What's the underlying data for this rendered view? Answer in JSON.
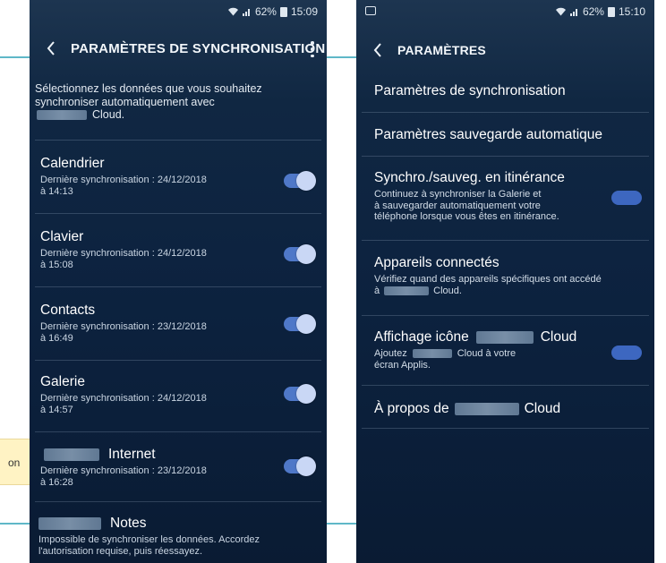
{
  "annotation": {
    "note_text": "on"
  },
  "left_screen": {
    "status": {
      "signal_text": "⚡.ıl",
      "battery": "62%",
      "time": "15:09"
    },
    "title": "PARAMÈTRES DE SYNCHRONISATION",
    "intro_line1": "Sélectionnez les données que vous souhaitez",
    "intro_line2": "synchroniser automatiquement avec",
    "intro_line3": "Cloud.",
    "items": [
      {
        "title": "Calendrier",
        "sub1": "Dernière synchronisation : 24/12/2018",
        "sub2": "à 14:13",
        "enabled": true
      },
      {
        "title": "Clavier",
        "sub1": "Dernière synchronisation : 24/12/2018",
        "sub2": "à 15:08",
        "enabled": true
      },
      {
        "title": "Contacts",
        "sub1": "Dernière synchronisation : 23/12/2018",
        "sub2": "à 16:49",
        "enabled": true
      },
      {
        "title": "Galerie",
        "sub1": "Dernière synchronisation : 24/12/2018",
        "sub2": "à 14:57",
        "enabled": true
      },
      {
        "title": "Internet",
        "sub1": "Dernière synchronisation : 23/12/2018",
        "sub2": "à 16:28",
        "enabled": true
      },
      {
        "title": "Notes",
        "sub1": "Impossible de synchroniser les données. Accordez",
        "sub2": "l'autorisation requise, puis réessayez."
      }
    ]
  },
  "right_screen": {
    "status": {
      "battery": "62%",
      "time": "15:10"
    },
    "title": "PARAMÈTRES",
    "items": [
      {
        "title": "Paramètres de synchronisation"
      },
      {
        "title": "Paramètres sauvegarde automatique"
      },
      {
        "title": "Synchro./sauveg. en itinérance",
        "sub1": "Continuez à synchroniser la Galerie et",
        "sub2": "à sauvegarder automatiquement votre",
        "sub3": "téléphone lorsque vous êtes en itinérance.",
        "enabled": true
      },
      {
        "title": "Appareils connectés",
        "sub1": "Vérifiez quand des appareils spécifiques ont accédé",
        "sub2_prefix": "à",
        "sub2_suffix": "Cloud."
      },
      {
        "title_prefix": "Affichage icône",
        "title_suffix": "Cloud",
        "sub1_prefix": "Ajoutez",
        "sub1_suffix": "Cloud à votre",
        "sub2": "écran Applis.",
        "enabled": true
      },
      {
        "title_prefix": "À propos de",
        "title_suffix": "Cloud"
      }
    ]
  },
  "colors": {
    "accent": "#4f78c8",
    "background": "#0d2340",
    "guide": "#5fb8c8",
    "note": "#fff3c4"
  }
}
